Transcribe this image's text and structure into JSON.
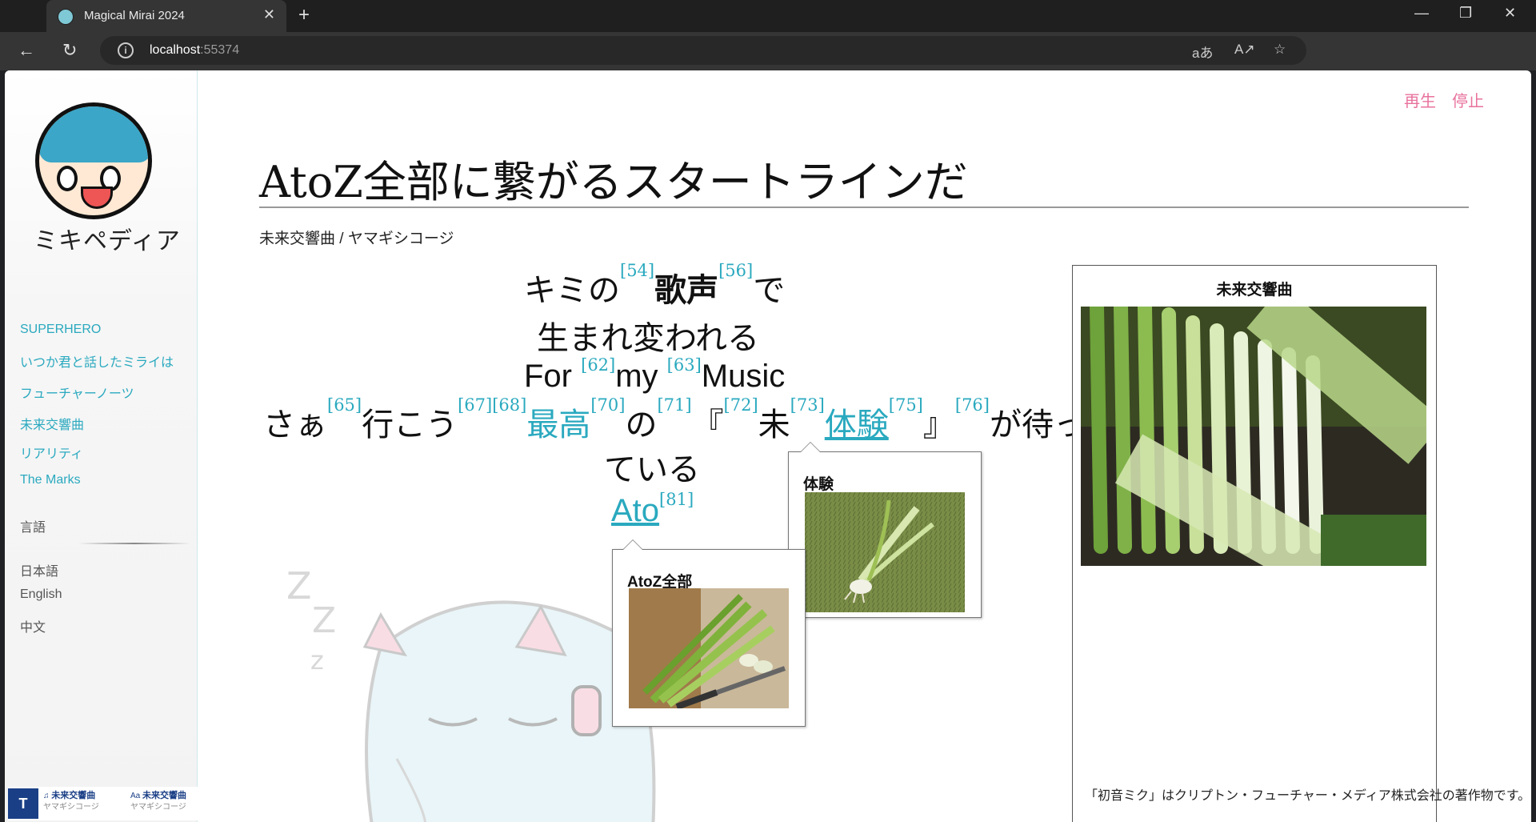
{
  "browser": {
    "tab_title": "Magical Mirai 2024",
    "url_host": "localhost",
    "url_port": ":55374"
  },
  "sidebar": {
    "logo_text": "ミキペディア",
    "songs": [
      "SUPERHERO",
      "いつか君と話したミライは",
      "フューチャーノーツ",
      "未来交響曲",
      "リアリティ",
      "The Marks"
    ],
    "language_label": "言語",
    "languages": [
      "日本語",
      "English",
      "中文"
    ]
  },
  "player": {
    "track1_title": "未来交響曲",
    "track1_artist": "ヤマギシコージ",
    "track2_title": "未来交響曲",
    "track2_artist": "ヤマギシコージ"
  },
  "controls": {
    "play": "再生",
    "stop": "停止"
  },
  "article": {
    "title": "AtoZ全部に繋がるスタートラインだ",
    "subtitle": "未来交響曲 / ヤマギシコージ"
  },
  "lyrics": {
    "l1_a": "キミの",
    "l1_r1": "[54]",
    "l1_b": "歌声",
    "l1_r2": "[56]",
    "l1_c": "で",
    "l2": "生まれ変われる",
    "l3_a": "For ",
    "l3_r1": "[62]",
    "l3_b": "my ",
    "l3_r2": "[63]",
    "l3_c": "Music",
    "l4_a": "さぁ",
    "l4_r1": "[65]",
    "l4_b": "行こう",
    "l4_r2": "[67][68]",
    "l4_c": "最高",
    "l4_r3": "[70]",
    "l4_d": "の",
    "l4_r4": "[71]",
    "l4_e": "『",
    "l4_r5": "[72]",
    "l4_f": "未",
    "l4_r6": "[73]",
    "l4_g": "体験",
    "l4_r7": "[75]",
    "l4_h": "』",
    "l4_r8": "[76]",
    "l4_i": "が待っ",
    "l5": "ている",
    "l6_a": "Ato",
    "l6_r1": "[81]"
  },
  "popups": {
    "p1_title": "体験",
    "p2_title": "AtoZ全部"
  },
  "infobox": {
    "title": "未来交響曲"
  },
  "footer": {
    "note": "「初音ミク」はクリプトン・フューチャー・メディア株式会社の著作物です。"
  },
  "colors": {
    "link": "#2aa9bf",
    "control": "#e8729d",
    "player_brand": "#1a3f86"
  }
}
